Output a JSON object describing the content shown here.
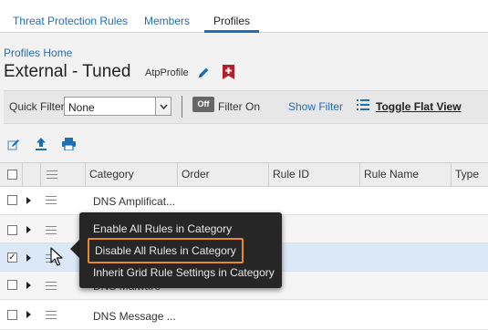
{
  "tabs": [
    {
      "label": "Threat Protection Rules"
    },
    {
      "label": "Members"
    },
    {
      "label": "Profiles",
      "active": true
    }
  ],
  "breadcrumb": "Profiles Home",
  "page_title": "External - Tuned",
  "profile_type": "AtpProfile",
  "filter": {
    "quick_filter_label": "Quick Filter",
    "quick_filter_value": "None",
    "toggle_label": "Off",
    "filter_on_label": "Filter On",
    "show_filter": "Show Filter",
    "toggle_flat_view": "Toggle Flat View"
  },
  "grid": {
    "columns": [
      "Category",
      "Order",
      "Rule ID",
      "Rule Name",
      "Type"
    ],
    "rows": [
      {
        "category": "DNS Amplificat...",
        "checked": false
      },
      {
        "category": "",
        "checked": false
      },
      {
        "category": "",
        "checked": true
      },
      {
        "category": "DNS Malware",
        "checked": false
      },
      {
        "category": "DNS Message ...",
        "checked": false
      }
    ]
  },
  "context_menu": {
    "items": [
      {
        "label": "Enable All Rules in Category"
      },
      {
        "label": "Disable All Rules in Category",
        "highlighted": true
      },
      {
        "label": "Inherit Grid Rule Settings in Category"
      }
    ]
  },
  "colors": {
    "accent": "#1f6fb5",
    "highlight_border": "#e8892b",
    "selected_row": "#dbe8f7",
    "menu_bg": "#262626",
    "delete_icon": "#b3202c"
  },
  "icons": [
    "edit-icon",
    "delete-icon",
    "edit-rules-icon",
    "upload-icon",
    "print-icon",
    "list-view-icon",
    "chevron-down-icon",
    "expand-icon",
    "drag-handle-icon",
    "mouse-cursor-icon"
  ]
}
